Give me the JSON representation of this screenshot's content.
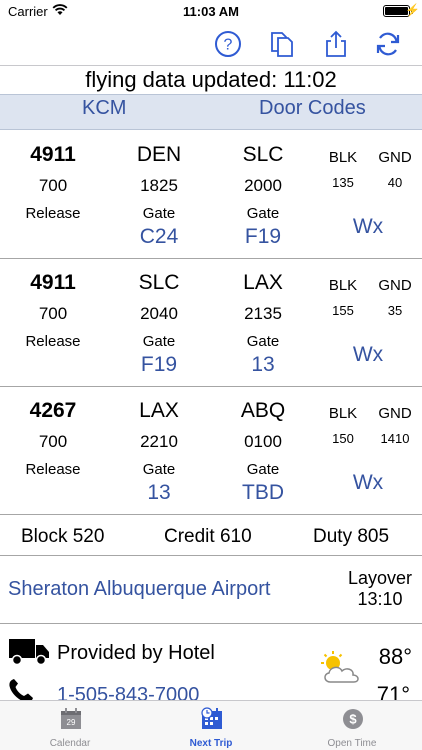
{
  "status_bar": {
    "carrier": "Carrier",
    "time": "11:03 AM"
  },
  "updated": {
    "text": "flying data updated: 11:02"
  },
  "links": {
    "left": "KCM",
    "right": "Door Codes"
  },
  "legs": [
    {
      "flight": "4911",
      "flight_sub": "700",
      "flight_label": "Release",
      "dep": "DEN",
      "dep_time": "1825",
      "dep_gate_label": "Gate",
      "dep_gate": "C24",
      "arr": "SLC",
      "arr_time": "2000",
      "arr_gate_label": "Gate",
      "arr_gate": "F19",
      "blk_label": "BLK",
      "blk": "135",
      "gnd_label": "GND",
      "gnd": "40",
      "wx": "Wx"
    },
    {
      "flight": "4911",
      "flight_sub": "700",
      "flight_label": "Release",
      "dep": "SLC",
      "dep_time": "2040",
      "dep_gate_label": "Gate",
      "dep_gate": "F19",
      "arr": "LAX",
      "arr_time": "2135",
      "arr_gate_label": "Gate",
      "arr_gate": "13",
      "blk_label": "BLK",
      "blk": "155",
      "gnd_label": "GND",
      "gnd": "35",
      "wx": "Wx"
    },
    {
      "flight": "4267",
      "flight_sub": "700",
      "flight_label": "Release",
      "dep": "LAX",
      "dep_time": "2210",
      "dep_gate_label": "Gate",
      "dep_gate": "13",
      "arr": "ABQ",
      "arr_time": "0100",
      "arr_gate_label": "Gate",
      "arr_gate": "TBD",
      "blk_label": "BLK",
      "blk": "150",
      "gnd_label": "GND",
      "gnd": "1410",
      "wx": "Wx"
    }
  ],
  "totals": {
    "block": "Block 520",
    "credit": "Credit 610",
    "duty": "Duty 805"
  },
  "hotel": {
    "name": "Sheraton Albuquerque Airport",
    "layover_label": "Layover",
    "layover_time": "13:10"
  },
  "transport": {
    "provided": "Provided by Hotel",
    "phone": "1-505-843-7000",
    "temp_high": "88°",
    "temp_low": "71°"
  },
  "tabs": [
    {
      "label": "Calendar",
      "badge": "29"
    },
    {
      "label": "Next Trip"
    },
    {
      "label": "Open Time",
      "badge": "$"
    }
  ],
  "colors": {
    "accent": "#3553a0",
    "tab_active": "#2f5bd3",
    "links_bg": "#dde4f0"
  }
}
